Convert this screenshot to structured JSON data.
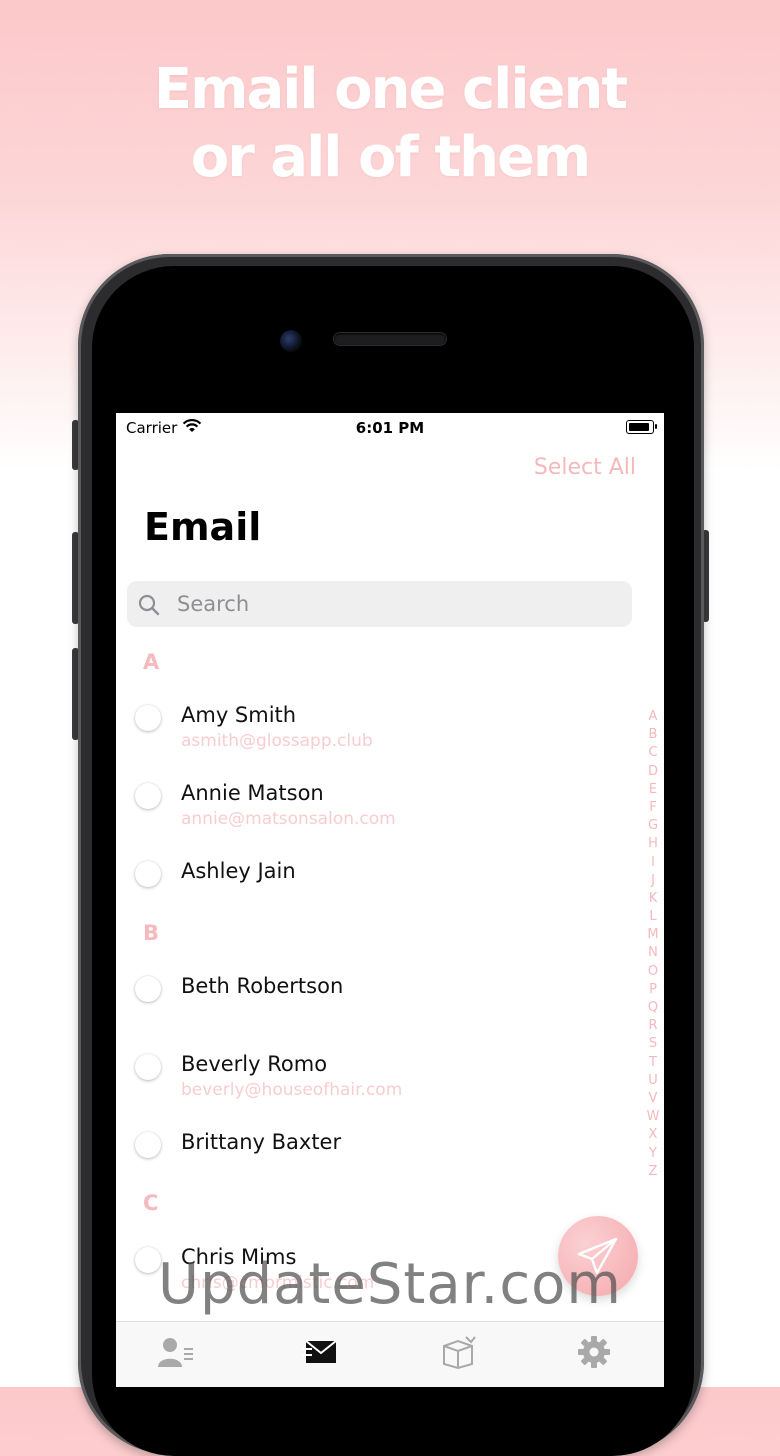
{
  "headline": {
    "line1": "Email one client",
    "line2": "or all of them"
  },
  "status_bar": {
    "carrier": "Carrier",
    "time": "6:01 PM"
  },
  "nav": {
    "select_all": "Select All",
    "title": "Email"
  },
  "search": {
    "placeholder": "Search"
  },
  "sections": [
    {
      "letter": "A",
      "clients": [
        {
          "name": "Amy Smith",
          "email": "asmith@glossapp.club"
        },
        {
          "name": "Annie Matson",
          "email": "annie@matsonsalon.com"
        },
        {
          "name": "Ashley Jain",
          "email": ""
        }
      ]
    },
    {
      "letter": "B",
      "clients": [
        {
          "name": "Beth Robertson",
          "email": ""
        },
        {
          "name": "Beverly Romo",
          "email": "beverly@houseofhair.com"
        },
        {
          "name": "Brittany Baxter",
          "email": ""
        }
      ]
    },
    {
      "letter": "C",
      "clients": [
        {
          "name": "Chris Mims",
          "email": "chris@cmormistic.com"
        }
      ]
    }
  ],
  "index_letters": [
    "A",
    "B",
    "C",
    "D",
    "E",
    "F",
    "G",
    "H",
    "I",
    "J",
    "K",
    "L",
    "M",
    "N",
    "O",
    "P",
    "Q",
    "R",
    "S",
    "T",
    "U",
    "V",
    "W",
    "X",
    "Y",
    "Z"
  ],
  "tabs": [
    {
      "icon": "clients-icon"
    },
    {
      "icon": "email-icon",
      "active": true
    },
    {
      "icon": "box-icon"
    },
    {
      "icon": "gear-icon"
    }
  ],
  "fab": {
    "icon": "paper-plane-icon"
  },
  "watermark": "UpdateStar.com",
  "colors": {
    "accent": "#f5b8bc",
    "background_top": "#fcc8ca"
  }
}
